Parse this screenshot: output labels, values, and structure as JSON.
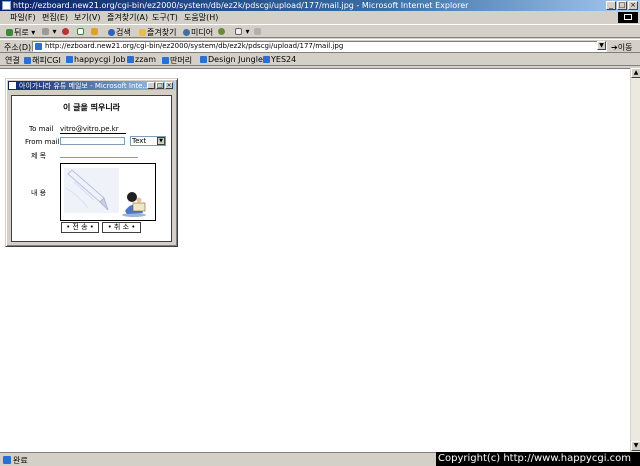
{
  "window": {
    "title": "http://ezboard.new21.org/cgi-bin/ez2000/system/db/ez2k/pdscgi/upload/177/mail.jpg - Microsoft Internet Explorer"
  },
  "menu": [
    "파일(F)",
    "편집(E)",
    "보기(V)",
    "즐겨찾기(A)",
    "도구(T)",
    "도움말(H)"
  ],
  "toolbar": {
    "back": "뒤로",
    "search": "검색",
    "favorites": "즐겨찾기",
    "media": "미디어"
  },
  "address": {
    "label": "주소(D)",
    "url": "http://ezboard.new21.org/cgi-bin/ez2000/system/db/ez2k/pdscgi/upload/177/mail.jpg",
    "go": "이동"
  },
  "links": {
    "label": "연결",
    "items": [
      "해피CGI",
      "happycgi Job",
      "zzam",
      "딴머리",
      "Design Jungle",
      "YES24"
    ]
  },
  "popup": {
    "title": "아이가나라 유튜 메일보 - Microsoft Inte...",
    "heading": "이 글을 띄우니라",
    "to_label": "To mail",
    "to_value": "vitro@vitro.pe.kr",
    "from_label": "From mail",
    "from_value": "",
    "type_value": "Text",
    "subject_label": "제 목",
    "content_label": "내 용",
    "send_button": "• 전 송 •",
    "cancel_button": "• 취 소 •"
  },
  "status": {
    "text": "완료"
  },
  "copyright": "Copyright(c) http://www.happycgi.com"
}
